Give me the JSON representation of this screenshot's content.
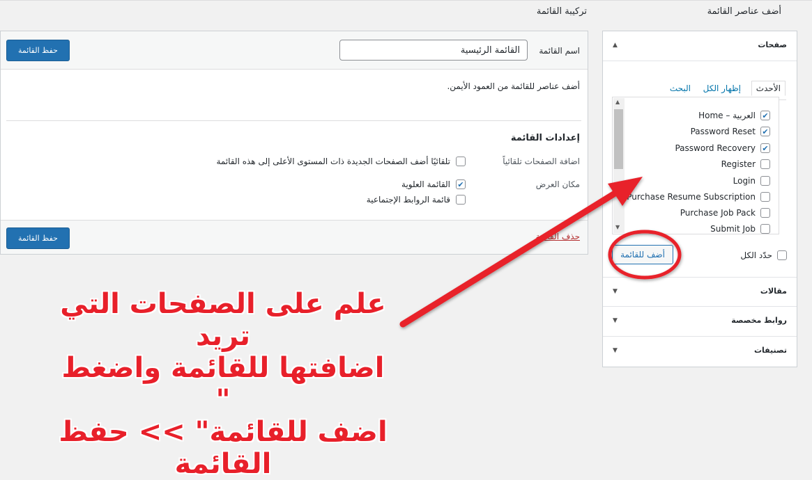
{
  "headers": {
    "add_menu_items": "أضف عناصر القائمة",
    "menu_structure": "تركيبة القائمة"
  },
  "sidebar": {
    "sections": [
      {
        "title": "صفحات",
        "expanded": true
      },
      {
        "title": "مقالات",
        "expanded": false
      },
      {
        "title": "روابط مخصصة",
        "expanded": false
      },
      {
        "title": "تصنيفات",
        "expanded": false
      }
    ],
    "tabs": {
      "recent": "الأحدث",
      "view_all": "إظهار الكل",
      "search": "البحث"
    },
    "pages": [
      {
        "label": "Home – العربية",
        "checked": true
      },
      {
        "label": "Password Reset",
        "checked": true
      },
      {
        "label": "Password Recovery",
        "checked": true
      },
      {
        "label": "Register",
        "checked": false
      },
      {
        "label": "Login",
        "checked": false
      },
      {
        "label": "Purchase Resume Subscription",
        "checked": false
      },
      {
        "label": "Purchase Job Pack",
        "checked": false
      },
      {
        "label": "Submit Job",
        "checked": false
      }
    ],
    "select_all": "حدّد الكل",
    "add_to_menu": "أضف للقائمة"
  },
  "main": {
    "menu_name_label": "اسم القائمة",
    "menu_name_value": "القائمة الرئيسية",
    "save_label": "حفظ القائمة",
    "instructions": "أضف عناصر للقائمة من العمود الأيمن.",
    "settings_title": "إعدادات القائمة",
    "auto_add_label": "اضافة الصفحات تلقائياً",
    "auto_add_option": "تلقائيًا أضف الصفحات الجديدة ذات المستوى الأعلى إلى هذه القائمة",
    "display_location_label": "مكان العرض",
    "locations": [
      {
        "label": "القائمة العلوية",
        "checked": true
      },
      {
        "label": "قائمة الروابط الإجتماعية",
        "checked": false
      }
    ],
    "delete_menu": "حذف القائمة"
  },
  "annotation": {
    "lines": [
      "علم على الصفحات التي تريد",
      "اضافتها للقائمة واضغط \"",
      "اضف للقائمة\" >> حفظ القائمة"
    ],
    "color": "#e8202a"
  },
  "icons": {
    "expanded": "triangle-up-icon",
    "collapsed": "triangle-down-icon",
    "checkmark": "checkmark-icon"
  }
}
